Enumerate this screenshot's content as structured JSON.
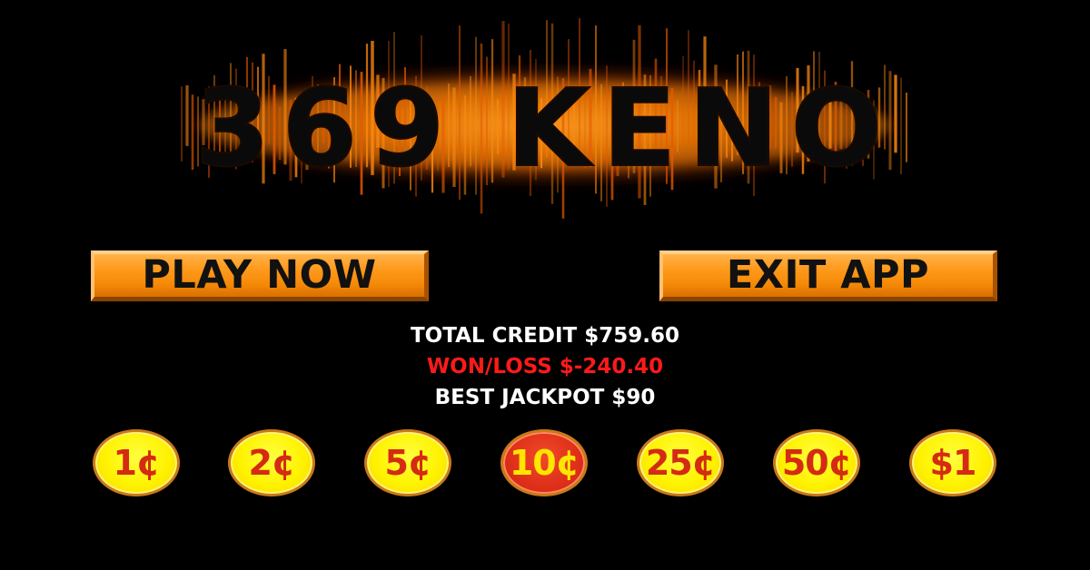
{
  "logo": {
    "text": "369 KENO",
    "text_color": "#0a0a0a",
    "glow_color": "#ff8a00"
  },
  "buttons": {
    "play_label": "PLAY NOW",
    "exit_label": "EXIT APP",
    "color": "#ff9a1c"
  },
  "stats": {
    "total_credit": "TOTAL CREDIT $759.60",
    "won_loss": "WON/LOSS $-240.40",
    "best_jackpot": "BEST JACKPOT $90",
    "won_loss_color": "#ff1a1a"
  },
  "denominations": [
    {
      "label": "1¢",
      "selected": false
    },
    {
      "label": "2¢",
      "selected": false
    },
    {
      "label": "5¢",
      "selected": false
    },
    {
      "label": "10¢",
      "selected": true
    },
    {
      "label": "25¢",
      "selected": false
    },
    {
      "label": "50¢",
      "selected": false
    },
    {
      "label": "$1",
      "selected": false
    }
  ],
  "colors": {
    "background": "#000000",
    "coin_yellow": "#fff200",
    "coin_selected": "#e0301a"
  }
}
